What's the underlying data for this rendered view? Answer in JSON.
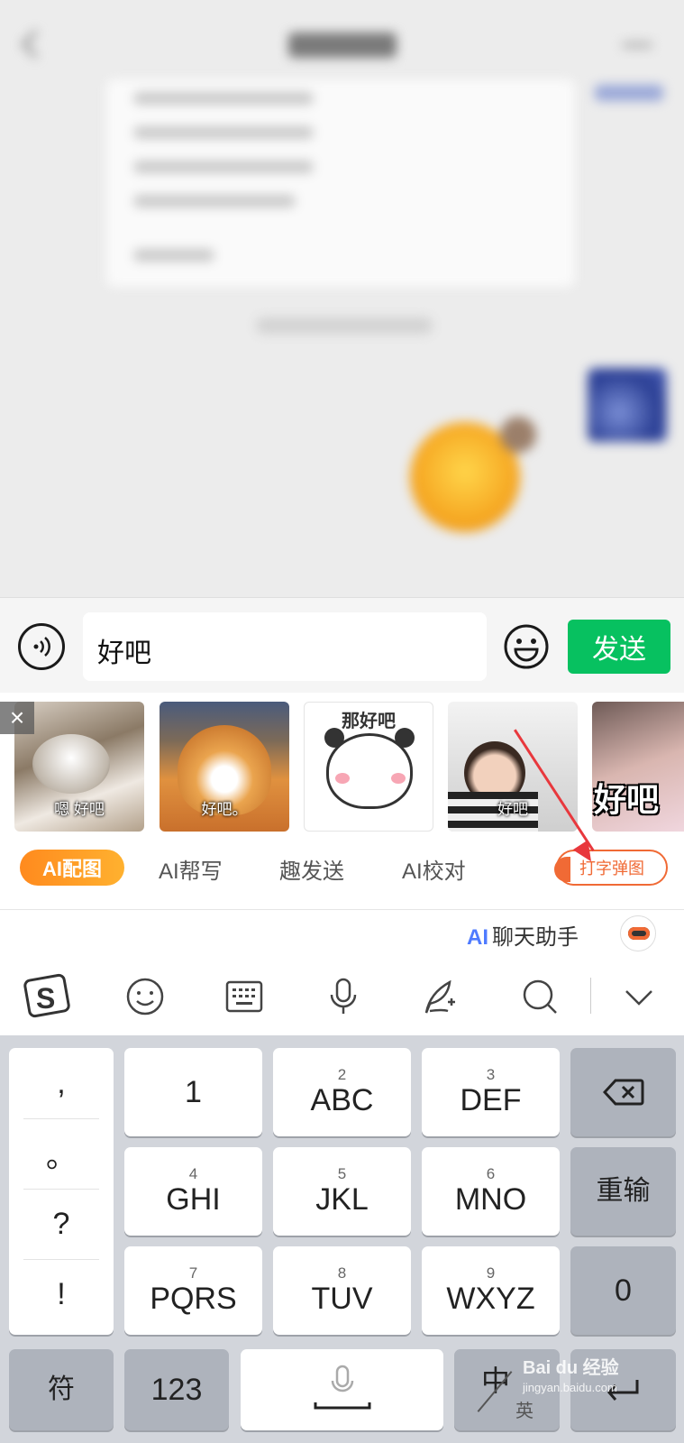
{
  "input": {
    "text": "好吧"
  },
  "send_label": "发送",
  "stickers": {
    "captions": [
      "嗯 好吧",
      "好吧。",
      "那好吧",
      "好吧",
      "好吧"
    ]
  },
  "ai_tabs": {
    "active": "AI配图",
    "items": [
      "AI帮写",
      "趣发送",
      "AI校对"
    ],
    "type_popup": "打字弹图"
  },
  "assistant": {
    "ai": "AI",
    "label": "聊天助手"
  },
  "punct": [
    ",",
    "。",
    "?",
    "!"
  ],
  "keys": [
    {
      "num": "",
      "main": "1"
    },
    {
      "num": "2",
      "main": "ABC"
    },
    {
      "num": "3",
      "main": "DEF"
    },
    {
      "num": "4",
      "main": "GHI"
    },
    {
      "num": "5",
      "main": "JKL"
    },
    {
      "num": "6",
      "main": "MNO"
    },
    {
      "num": "7",
      "main": "PQRS"
    },
    {
      "num": "8",
      "main": "TUV"
    },
    {
      "num": "9",
      "main": "WXYZ"
    }
  ],
  "side_keys": {
    "retype": "重输",
    "zero": "0"
  },
  "bottom_keys": {
    "symbol": "符",
    "numbers": "123",
    "zh": "中",
    "en": "英"
  },
  "watermark": {
    "brand": "Bai du 经验",
    "url": "jingyan.baidu.com"
  },
  "colors": {
    "send_green": "#07c160",
    "ai_orange": "#ff8a1e",
    "popup_red": "#f06a35",
    "arrow_red": "#e8383d"
  }
}
